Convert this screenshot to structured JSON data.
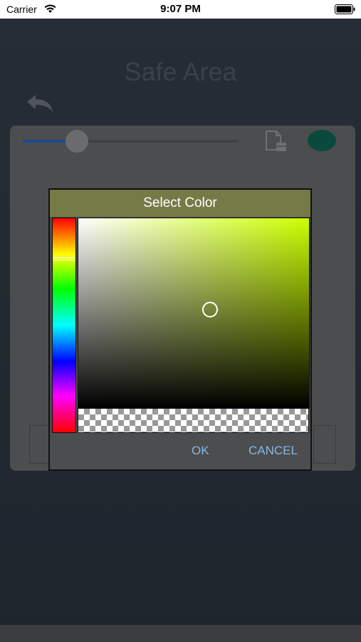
{
  "status_bar": {
    "carrier": "Carrier",
    "time": "9:07 PM"
  },
  "page": {
    "title": "Safe Area"
  },
  "slider": {
    "value_fraction": 0.25
  },
  "colors": {
    "selected_swatch": "#0a4a3c",
    "header_bg": "#767a47",
    "hue_color": "#ccff00",
    "accent": "#87b8e6"
  },
  "dialog": {
    "title": "Select Color",
    "hue_fraction": 0.19,
    "saturation": 0.57,
    "value": 0.52,
    "ok_label": "OK",
    "cancel_label": "CANCEL"
  },
  "icons": {
    "back": "undo-arrow-icon",
    "document": "document-stack-icon",
    "wifi": "wifi-icon",
    "battery": "battery-icon"
  }
}
